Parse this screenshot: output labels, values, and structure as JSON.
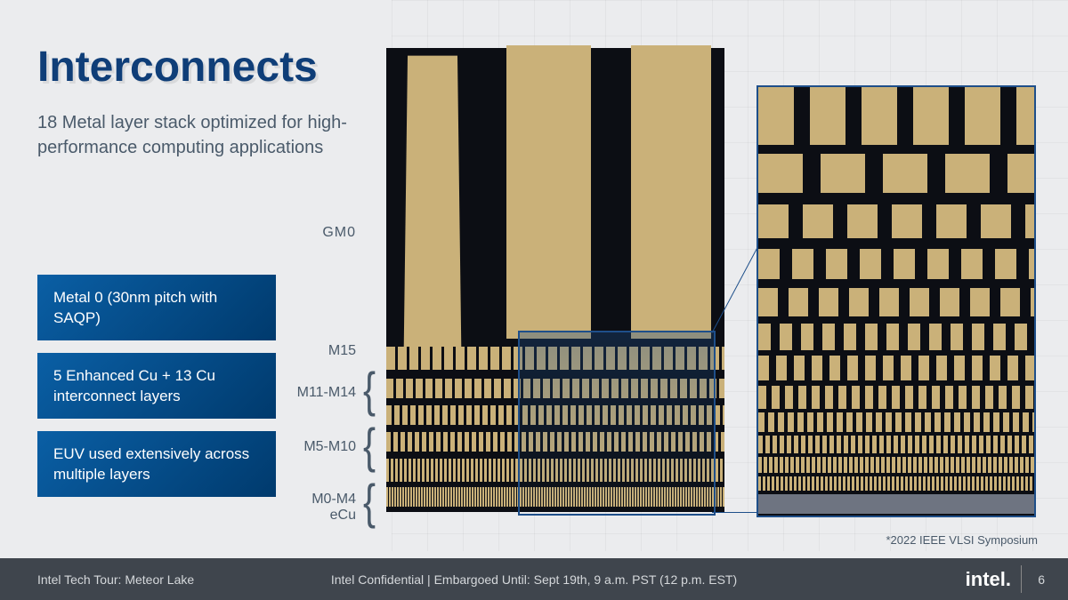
{
  "title": "Interconnects",
  "subtitle": "18 Metal layer stack optimized for high-performance computing applications",
  "callouts": {
    "c1": "Metal 0 (30nm pitch with SAQP)",
    "c2": "5 Enhanced Cu + 13 Cu interconnect layers",
    "c3": "EUV used extensively across multiple layers"
  },
  "layer_labels": {
    "l1": "GM0",
    "l2": "M15",
    "l3": "M11-M14",
    "l4": "M5-M10",
    "l5": "M0-M4 eCu"
  },
  "footnote": "*2022 IEEE VLSI Symposium",
  "footer": {
    "left": "Intel Tech Tour: Meteor Lake",
    "center": "Intel Confidential   |   Embargoed Until: Sept 19th, 9 a.m. PST (12 p.m. EST)",
    "brand": "intel.",
    "page": "6"
  }
}
